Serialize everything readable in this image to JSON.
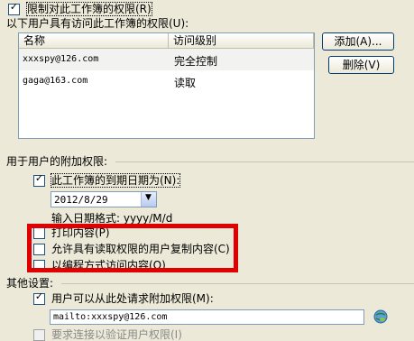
{
  "restrict": {
    "checked": true,
    "label": "限制对此工作簿的权限(R)"
  },
  "users_group": {
    "label": "以下用户具有访问此工作簿的权限(U):",
    "columns": [
      "名称",
      "访问级别"
    ],
    "rows": [
      {
        "name": "xxxspy@126.com",
        "level": "完全控制"
      },
      {
        "name": "gaga@163.com",
        "level": "读取"
      }
    ],
    "add_button": "添加(A)...",
    "remove_button": "删除(V)"
  },
  "extra": {
    "title": "用于用户的附加权限:",
    "expires": {
      "checked": true,
      "label": "此工作簿的到期日期为(N):"
    },
    "date_value": "2012/8/29",
    "date_format": "输入日期格式: yyyy/M/d",
    "print": {
      "checked": false,
      "label": "打印内容(P)"
    },
    "copy": {
      "checked": false,
      "label": "允许具有读取权限的用户复制内容(C)"
    },
    "programmatic": {
      "checked": false,
      "label": "以编程方式访问内容(O)"
    }
  },
  "other": {
    "title": "其他设置:",
    "request": {
      "checked": true,
      "label": "用户可以从此处请求附加权限(M):"
    },
    "mailto_value": "mailto:xxxspy@126.com",
    "verify": {
      "checked": false,
      "label": "要求连接以验证用户权限(I)"
    }
  },
  "colors": {
    "highlight_box": "#e00000",
    "dialog_bg": "#ece9d8"
  }
}
